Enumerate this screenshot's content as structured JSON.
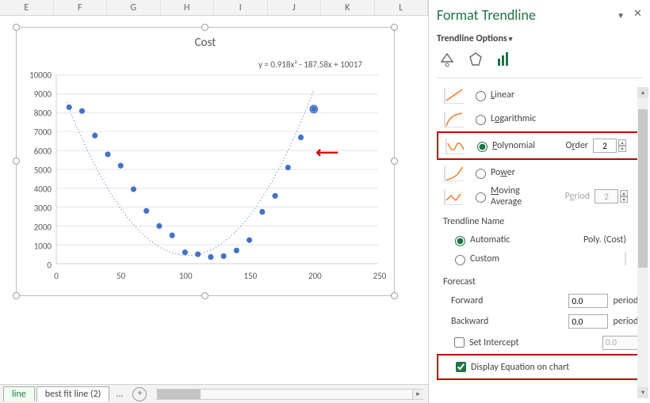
{
  "columns": [
    "E",
    "F",
    "G",
    "H",
    "I",
    "J",
    "K",
    "L"
  ],
  "chart": {
    "title": "Cost",
    "equation": "y = 0.918x² - 187.58x + 10017"
  },
  "chart_data": {
    "type": "scatter",
    "title": "Cost",
    "xlabel": "",
    "ylabel": "",
    "xlim": [
      0,
      250
    ],
    "ylim": [
      0,
      10000
    ],
    "yticks": [
      0,
      1000,
      2000,
      3000,
      4000,
      5000,
      6000,
      7000,
      8000,
      9000,
      10000
    ],
    "xticks": [
      0,
      50,
      100,
      150,
      200,
      250
    ],
    "series": [
      {
        "name": "Cost",
        "x": [
          10,
          20,
          30,
          40,
          50,
          60,
          70,
          80,
          90,
          100,
          110,
          120,
          130,
          140,
          150,
          160,
          170,
          180,
          190,
          200
        ],
        "y": [
          8300,
          8100,
          6800,
          5800,
          5200,
          3950,
          2800,
          2000,
          1500,
          600,
          500,
          350,
          400,
          700,
          1250,
          2750,
          3600,
          5100,
          6700,
          8200
        ]
      }
    ],
    "trendline": {
      "type": "polynomial",
      "order": 2,
      "equation": "y = 0.918x^2 - 187.58x + 10017"
    }
  },
  "tabs": {
    "active": "line",
    "items": [
      "line",
      "best fit line (2)"
    ],
    "more": "..."
  },
  "pane": {
    "title": "Format Trendline",
    "options_header": "Trendline Options",
    "types": {
      "linear": "Linear",
      "logarithmic": "Logarithmic",
      "polynomial": "Polynomial",
      "power": "Power",
      "moving_average": "Moving Average"
    },
    "order_label": "Order",
    "order_value": "2",
    "period_label": "Period",
    "period_value": "2",
    "name_hdr": "Trendline Name",
    "automatic": "Automatic",
    "auto_value": "Poly. (Cost)",
    "custom": "Custom",
    "forecast_hdr": "Forecast",
    "forward": "Forward",
    "backward": "Backward",
    "fwd_val": "0.0",
    "bwd_val": "0.0",
    "periods": "periods",
    "set_intercept": "Set Intercept",
    "intercept_val": "0.0",
    "display_eq": "Display Equation on chart"
  }
}
